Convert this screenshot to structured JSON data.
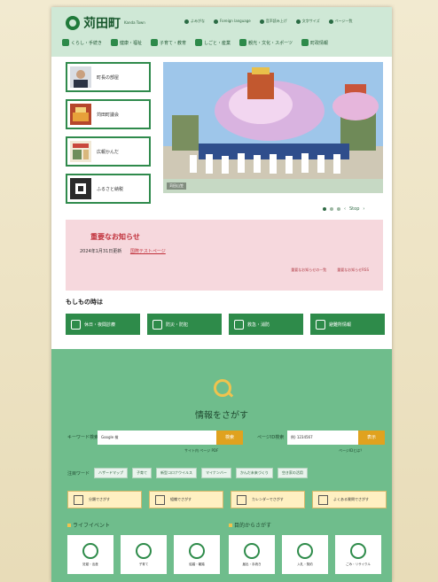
{
  "header": {
    "logo_text": "苅田町",
    "logo_sub": "Kanda Town",
    "utils": [
      "よみがな",
      "Foreign language",
      "音声読み上げ",
      "文字サイズ",
      "ページ一覧"
    ],
    "gnav": [
      "くらし・手続き",
      "健康・福祉",
      "子育て・教育",
      "しごと・産業",
      "観光・文化・スポーツ",
      "町政情報"
    ]
  },
  "side_cards": [
    "町長の部屋",
    "苅田町議会",
    "広報かんだ",
    "ふるさと納税"
  ],
  "slide": {
    "caption": "苅田山笠"
  },
  "carousel": {
    "stop_label": "Stop"
  },
  "notice": {
    "title": "重要なお知らせ",
    "date": "2024年1月31日更新",
    "link": "国際テストページ",
    "more_left": "重要なお知らせの一覧",
    "more_right": "重要なお知らせRSS"
  },
  "emergency": {
    "title": "もしもの時は",
    "buttons": [
      "休日・夜間診療",
      "防災・防犯",
      "救急・消防",
      "避難所情報"
    ]
  },
  "search": {
    "title": "情報をさがす",
    "kw_label": "キーワード検索",
    "kw_value": "Google 検",
    "kw_button": "検索",
    "page_label": "ページID検索",
    "page_value": "例) 1234567",
    "page_button": "表示",
    "hint_left": "サイト内 ページ PDF",
    "hint_right": "ページIDとは？",
    "tags_label": "注目ワード",
    "tags": [
      "ハザードマップ",
      "子育て",
      "新型コロナウイルス",
      "マイナンバー",
      "かんだ未来づくり",
      "空き家の活用"
    ],
    "wide_buttons": [
      "分類でさがす",
      "組織でさがす",
      "カレンダーでさがす",
      "よくある質問でさがす"
    ],
    "life_title": "ライフイベント",
    "purpose_title": "目的からさがす",
    "life_tiles": [
      "妊娠・出産",
      "子育て",
      "結婚・離婚"
    ],
    "purpose_tiles": [
      "届出・手続き",
      "入札・契約",
      "ごみ・リサイクル"
    ]
  }
}
